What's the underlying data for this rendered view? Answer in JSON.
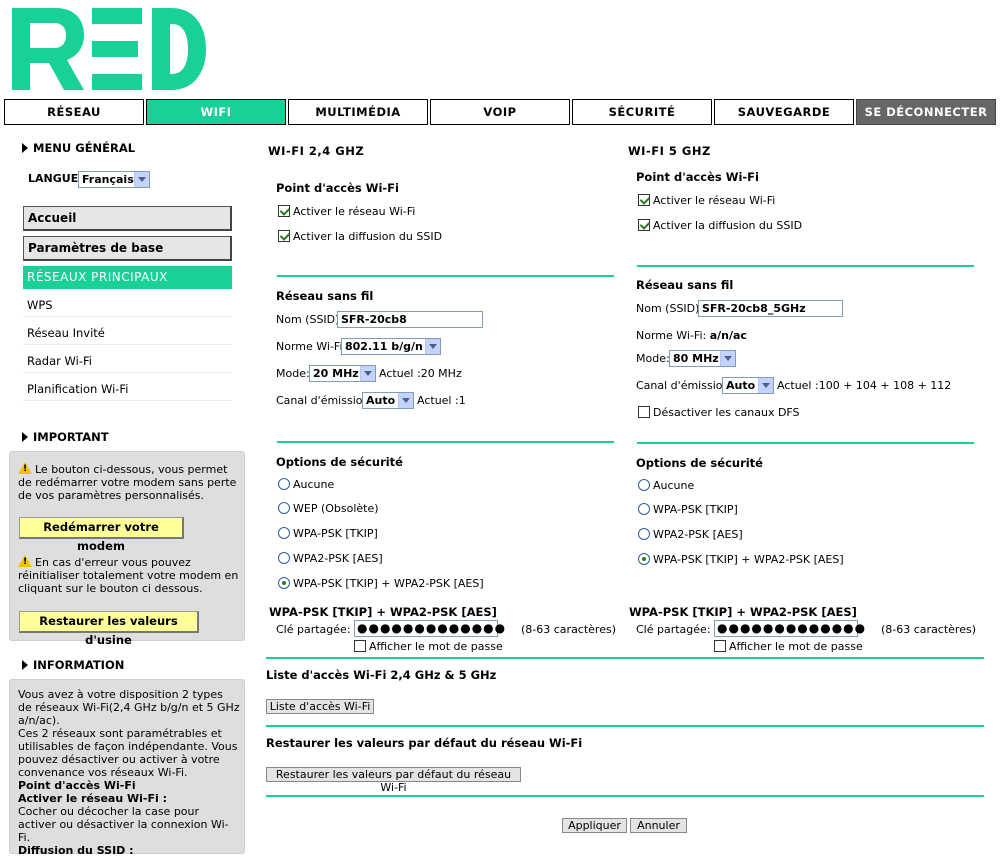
{
  "logo": {
    "text": "RED",
    "color": "#19d198"
  },
  "nav": [
    {
      "label": "RÉSEAU"
    },
    {
      "label": "WIFI"
    },
    {
      "label": "MULTIMÉDIA"
    },
    {
      "label": "VOIP"
    },
    {
      "label": "SÉCURITÉ"
    },
    {
      "label": "SAUVEGARDE"
    },
    {
      "label": "SE DÉCONNECTER"
    }
  ],
  "sidebar": {
    "menu_general": "MENU GÉNÉRAL",
    "langue_label": "LANGUE",
    "langue_value": "Français",
    "menu": {
      "accueil": "Accueil",
      "params": "Paramètres de base",
      "reseaux": "RÉSEAUX PRINCIPAUX",
      "wps": "WPS",
      "invite": "Réseau Invité",
      "radar": "Radar Wi-Fi",
      "planif": "Planification Wi-Fi"
    },
    "important": {
      "title": "IMPORTANT",
      "text1": "Le bouton ci-dessous, vous permet de redémarrer votre modem sans perte de vos paramètres personnalisés.",
      "btn1": "Redémarrer votre modem",
      "text2": "En cas d'erreur vous pouvez réinitialiser totalement votre modem en cliquant sur le bouton ci dessous.",
      "btn2": "Restaurer les valeurs d'usine"
    },
    "information": {
      "title": "INFORMATION",
      "p1": "Vous avez à votre disposition 2 types de réseaux Wi-Fi(2,4 GHz b/g/n et 5 GHz a/n/ac).",
      "p2": "Ces 2 réseaux sont paramétrables et utilisables de façon indépendante. Vous pouvez désactiver ou activer à votre convenance vos réseaux Wi-Fi.",
      "h1": "Point d'accès Wi-Fi",
      "h2": "Activer le réseau Wi-Fi :",
      "p3": "Cocher ou décocher la case pour activer ou désactiver la connexion Wi-Fi.",
      "h3": "Diffusion du SSID :"
    }
  },
  "w24": {
    "title": "WI-FI 2,4 GHZ",
    "ap_title": "Point d'accès Wi-Fi",
    "enable": "Activer le réseau Wi-Fi",
    "ssid_broadcast": "Activer la diffusion du SSID",
    "net_title": "Réseau sans fil",
    "ssid_label": "Nom (SSID):",
    "ssid_value": "SFR-20cb8",
    "norme_label": "Norme Wi-Fi:",
    "norme_value": "802.11 b/g/n",
    "mode_label": "Mode:",
    "mode_value": "20 MHz",
    "mode_actual": "Actuel :20 MHz",
    "canal_label": "Canal d'émission:",
    "canal_value": "Auto",
    "canal_actual": "Actuel :1",
    "sec_title": "Options de sécurité",
    "opt_none": "Aucune",
    "opt_wep": "WEP (Obsolète)",
    "opt_wpa": "WPA-PSK [TKIP]",
    "opt_wpa2": "WPA2-PSK [AES]",
    "opt_mixed": "WPA-PSK [TKIP] + WPA2-PSK [AES]",
    "key_title": "WPA-PSK [TKIP] + WPA2-PSK [AES]",
    "key_label": "Clé partagée:",
    "key_value": "●●●●●●●●●●●●●",
    "key_hint": "(8-63 caractères)",
    "show_pwd": "Afficher le mot de passe"
  },
  "w5": {
    "title": "WI-FI 5 GHZ",
    "ap_title": "Point d'accès Wi-Fi",
    "enable": "Activer le réseau Wi-Fi",
    "ssid_broadcast": "Activer la diffusion du SSID",
    "net_title": "Réseau sans fil",
    "ssid_label": "Nom (SSID):",
    "ssid_value": "SFR-20cb8_5GHz",
    "norme_label": "Norme Wi-Fi:",
    "norme_value": "a/n/ac",
    "mode_label": "Mode:",
    "mode_value": "80 MHz",
    "canal_label": "Canal d'émission:",
    "canal_value": "Auto",
    "canal_actual": "Actuel :100 + 104 + 108 + 112",
    "dfs": "Désactiver les canaux DFS",
    "sec_title": "Options de sécurité",
    "opt_none": "Aucune",
    "opt_wpa": "WPA-PSK [TKIP]",
    "opt_wpa2": "WPA2-PSK [AES]",
    "opt_mixed": "WPA-PSK [TKIP] + WPA2-PSK [AES]",
    "key_title": "WPA-PSK [TKIP] + WPA2-PSK [AES]",
    "key_label": "Clé partagée:",
    "key_value": "●●●●●●●●●●●●●",
    "key_hint": "(8-63 caractères)",
    "show_pwd": "Afficher le mot de passe"
  },
  "bottom": {
    "acl_title": "Liste d'accès Wi-Fi 2,4 GHz & 5 GHz",
    "acl_btn": "Liste d'accès Wi-Fi",
    "restore_title": "Restaurer les valeurs par défaut du réseau Wi-Fi",
    "restore_btn": "Restaurer les valeurs par défaut du réseau Wi-Fi",
    "apply": "Appliquer",
    "cancel": "Annuler"
  }
}
